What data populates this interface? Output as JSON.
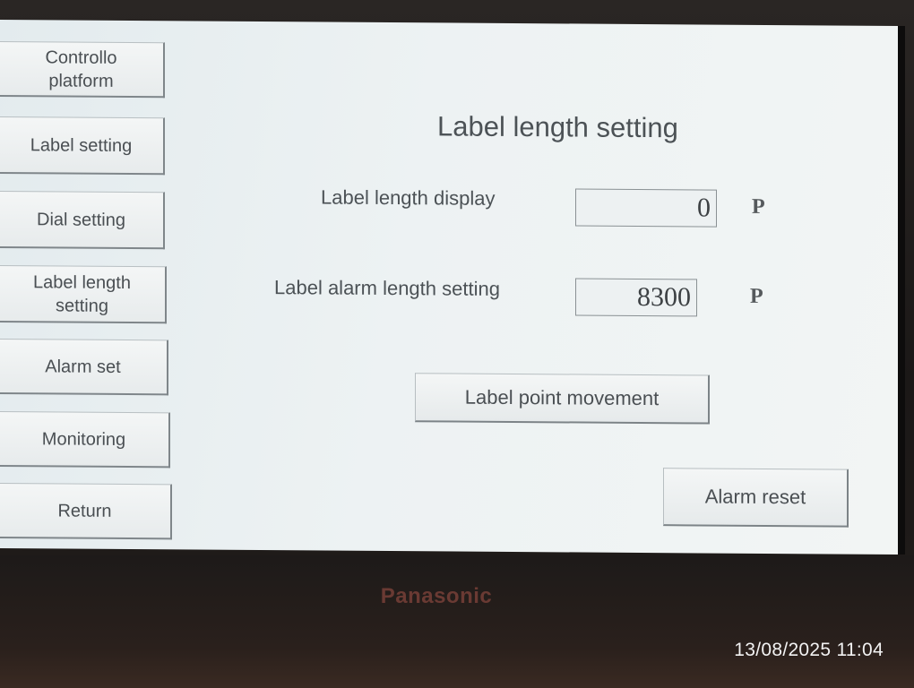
{
  "sidebar": {
    "items": [
      {
        "label": "Controllo\nplatform"
      },
      {
        "label": "Label setting"
      },
      {
        "label": "Dial setting"
      },
      {
        "label": "Label length\nsetting"
      },
      {
        "label": "Alarm set"
      },
      {
        "label": "Monitoring"
      },
      {
        "label": "Return"
      }
    ]
  },
  "main": {
    "title": "Label length setting",
    "length_display": {
      "label": "Label length display",
      "value": "0",
      "unit": "P"
    },
    "alarm_length": {
      "label": "Label alarm length setting",
      "value": "8300",
      "unit": "P"
    },
    "point_movement_label": "Label point movement",
    "alarm_reset_label": "Alarm reset"
  },
  "device": {
    "brand": "Panasonic"
  },
  "photo": {
    "timestamp": "13/08/2025 11:04"
  }
}
